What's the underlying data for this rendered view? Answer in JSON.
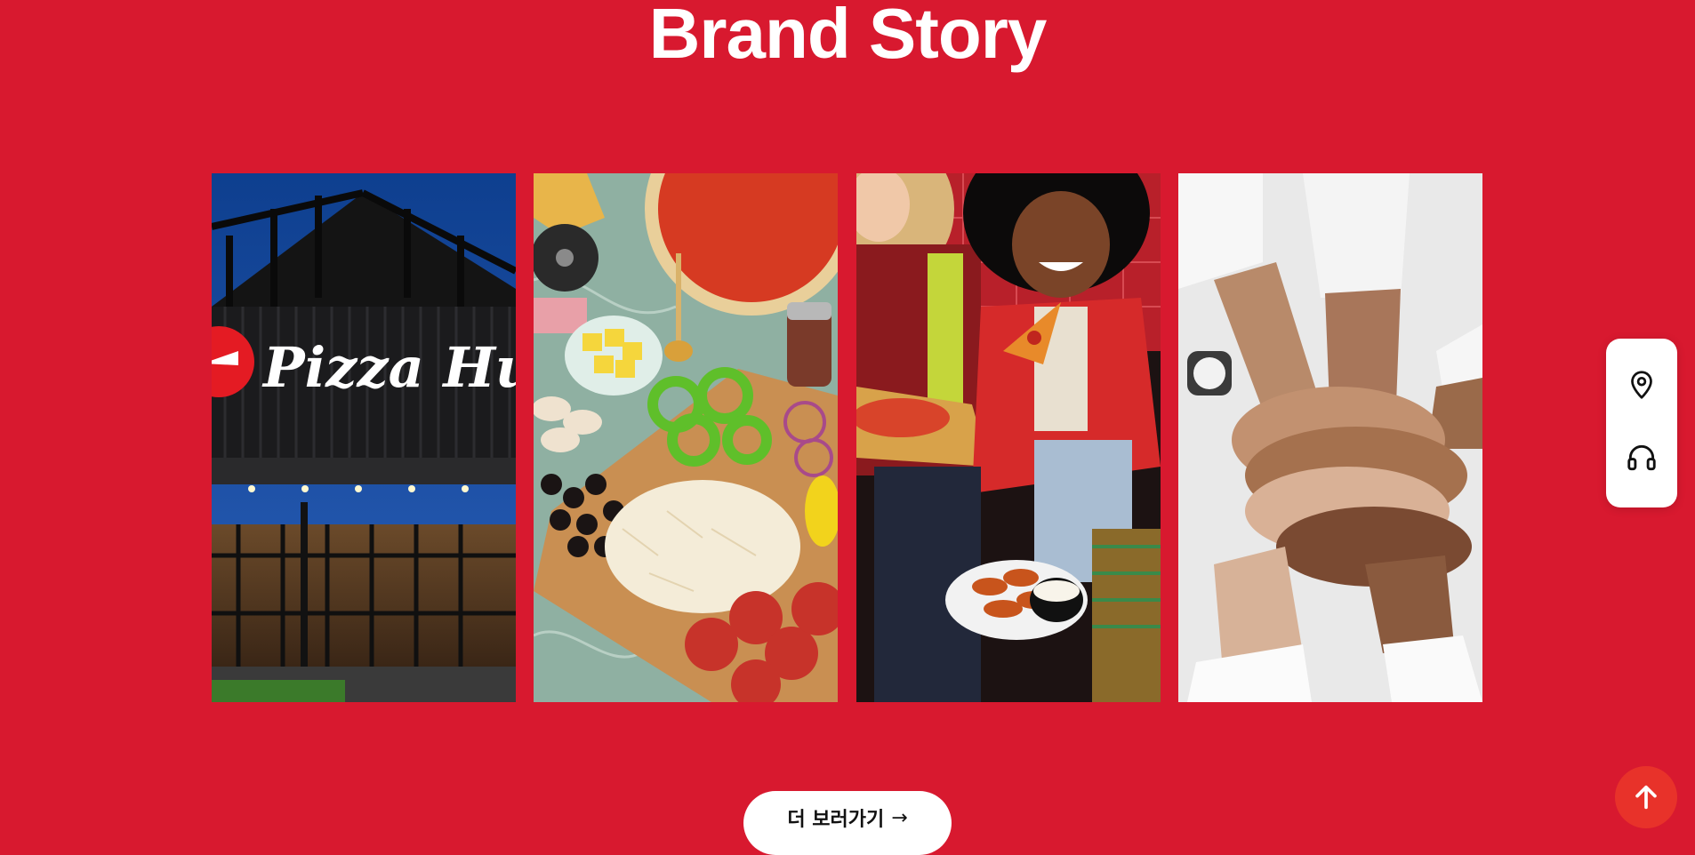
{
  "section": {
    "title": "Brand Story"
  },
  "cards": [
    {
      "subject": "pizza-hut-storefront",
      "sign_text": "Pizza Hut"
    },
    {
      "subject": "pizza-ingredients-board"
    },
    {
      "subject": "friends-sharing-pizza"
    },
    {
      "subject": "team-hands-together"
    }
  ],
  "more_button": {
    "label": "더 보러가기",
    "arrow": "→"
  },
  "quick_menu": [
    {
      "icon": "map-pin-icon"
    },
    {
      "icon": "headset-icon"
    }
  ],
  "top_button": {
    "icon": "arrow-up-icon"
  },
  "colors": {
    "background": "#d8192f",
    "top_button": "#e8322a",
    "text_on_background": "#ffffff"
  }
}
